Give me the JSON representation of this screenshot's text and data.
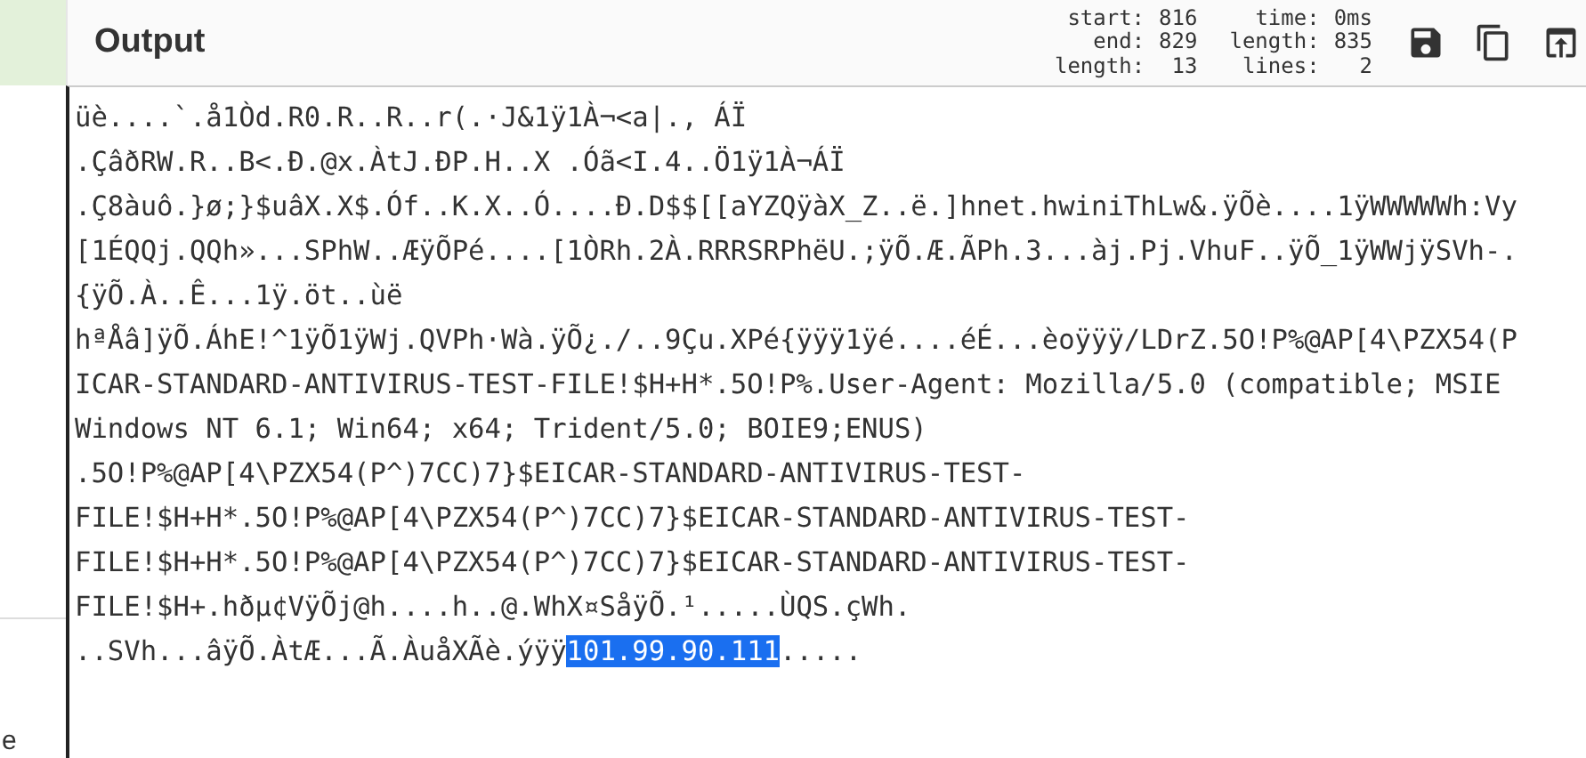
{
  "side_panel": {
    "text": "e"
  },
  "output": {
    "title": "Output",
    "stats": [
      [
        {
          "label": "start:",
          "value": "816"
        },
        {
          "label": "end:",
          "value": "829"
        },
        {
          "label": "length:",
          "value": "13"
        }
      ],
      [
        {
          "label": "time:",
          "value": "0ms"
        },
        {
          "label": "length:",
          "value": "835"
        },
        {
          "label": "lines:",
          "value": "2"
        }
      ]
    ],
    "actions": [
      {
        "kind": "save"
      },
      {
        "kind": "copy"
      },
      {
        "kind": "replace"
      }
    ],
    "lines": [
      [
        {
          "text": "üè....`.å1Òd.R0.R..R..r(.·J&1ÿ1À¬<a|., ÁÏ",
          "selected": false
        }
      ],
      [
        {
          "text": ".ÇâðRW.R..B<.Ð.@x.ÀtJ.ÐP.H..X .Óã<I.4..Ö1ÿ1À¬ÁÏ",
          "selected": false
        }
      ],
      [
        {
          "text": ".Ç8àuô.}ø;}$uâX.X$.Óf..K.X..Ó....Ð.D$$[[aYZQÿàX_Z..ë.]hnet.hwiniThLw&.ÿÕè....1ÿWWWWWh:Vy",
          "selected": false
        }
      ],
      [
        {
          "text": "[1ÉQQj.QQh»...SPhW..ÆÿÕPé....[1ÒRh.2À.RRRSRPhëU.;ÿÕ.Æ.ÃPh.3...àj.Pj.VhuF..ÿÕ_1ÿWWjÿSVh-.",
          "selected": false
        }
      ],
      [
        {
          "text": "{ÿÕ.À..Ê...1ÿ.öt..ùë",
          "selected": false
        }
      ],
      [
        {
          "text": "hªÅâ]ÿÕ.ÁhE!^1ÿÕ1ÿWj.QVPh·Wà.ÿÕ¿./..9Çu.XPé{ÿÿÿ1ÿé....éÉ...èoÿÿÿ/LDrZ.5O!P%@AP[4\\PZX54(P",
          "selected": false
        }
      ],
      [
        {
          "text": "ICAR-STANDARD-ANTIVIRUS-TEST-FILE!$H+H*.5O!P%.User-Agent: Mozilla/5.0 (compatible; MSIE",
          "selected": false
        }
      ],
      [
        {
          "text": "Windows NT 6.1; Win64; x64; Trident/5.0; BOIE9;ENUS)",
          "selected": false
        }
      ],
      [
        {
          "text": ".5O!P%@AP[4\\PZX54(P^)7CC)7}$EICAR-STANDARD-ANTIVIRUS-TEST-",
          "selected": false
        }
      ],
      [
        {
          "text": "FILE!$H+H*.5O!P%@AP[4\\PZX54(P^)7CC)7}$EICAR-STANDARD-ANTIVIRUS-TEST-",
          "selected": false
        }
      ],
      [
        {
          "text": "FILE!$H+H*.5O!P%@AP[4\\PZX54(P^)7CC)7}$EICAR-STANDARD-ANTIVIRUS-TEST-",
          "selected": false
        }
      ],
      [
        {
          "text": "FILE!$H+.hðµ¢VÿÕj@h....h..@.WhX¤SåÿÕ.¹.....ÙQS.çWh.",
          "selected": false
        }
      ],
      [
        {
          "text": "..SVh...âÿÕ.ÀtÆ...Ã.ÀuåXÃè.ýÿÿ",
          "selected": false
        },
        {
          "text": "101.99.90.111",
          "selected": true
        },
        {
          "text": ".....",
          "selected": false
        }
      ]
    ]
  }
}
